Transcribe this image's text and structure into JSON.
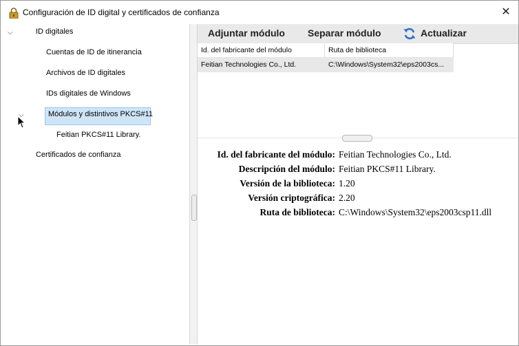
{
  "window": {
    "title": "Configuración de ID digital y certificados de confianza",
    "close_glyph": "✕",
    "title_icon": "lock-icon"
  },
  "tree": {
    "chevron_glyph": "⌵",
    "items": [
      {
        "label": "ID digitales"
      },
      {
        "label": "Cuentas de ID de itinerancia"
      },
      {
        "label": "Archivos de ID digitales"
      },
      {
        "label": "IDs digitales de Windows"
      },
      {
        "label": "Módulos y distintivos PKCS#11"
      },
      {
        "label": "Feitian PKCS#11 Library."
      },
      {
        "label": "Certificados de confianza"
      }
    ]
  },
  "toolbar": {
    "attach_label": "Adjuntar módulo",
    "detach_label": "Separar módulo",
    "refresh_label": "Actualizar",
    "refresh_icon": "refresh-icon"
  },
  "grid": {
    "columns": [
      "Id. del fabricante del módulo",
      "Ruta de biblioteca"
    ],
    "rows": [
      [
        "Feitian Technologies Co., Ltd.",
        "C:\\Windows\\System32\\eps2003cs..."
      ]
    ]
  },
  "details": [
    {
      "label": "Id. del fabricante del módulo:",
      "value": "Feitian Technologies Co., Ltd."
    },
    {
      "label": "Descripción del módulo:",
      "value": "Feitian PKCS#11 Library."
    },
    {
      "label": "Versión de la biblioteca:",
      "value": "1.20"
    },
    {
      "label": "Versión criptográfica:",
      "value": "2.20"
    },
    {
      "label": "Ruta de biblioteca:",
      "value": "C:\\Windows\\System32\\eps2003csp11.dll"
    }
  ],
  "colors": {
    "selection": "#cfe5f7",
    "toolbar_bg": "#e9e9e9",
    "refresh_blue": "#2a6fc9"
  }
}
